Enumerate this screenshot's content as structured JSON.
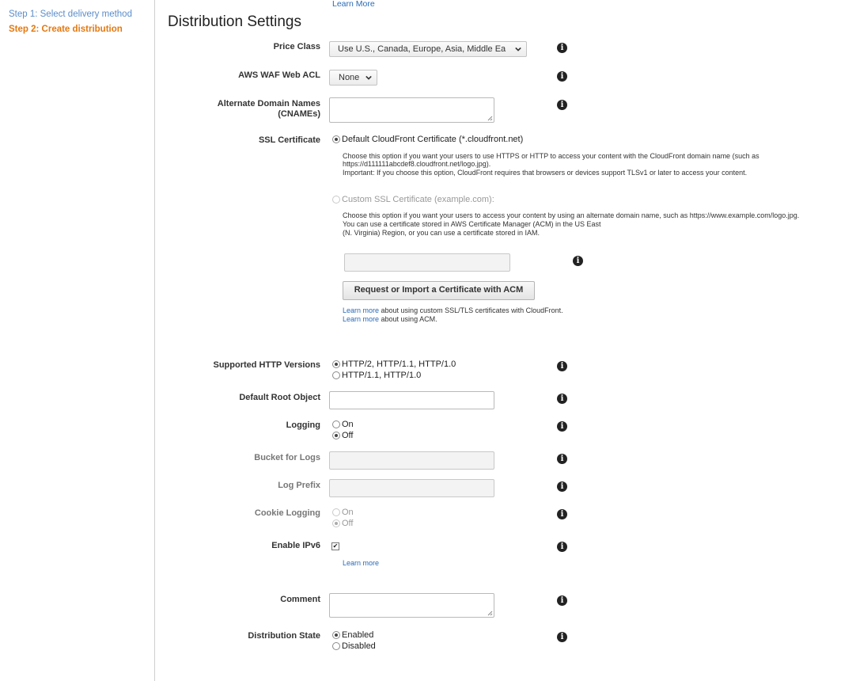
{
  "sidebar": {
    "step1": "Step 1: Select delivery method",
    "step2": "Step 2: Create distribution"
  },
  "top_link": "Learn More",
  "heading": "Distribution Settings",
  "price_class": {
    "label": "Price Class",
    "value": "Use U.S., Canada, Europe, Asia, Middle Ea"
  },
  "waf": {
    "label": "AWS WAF Web ACL",
    "value": "None"
  },
  "cnames": {
    "label_line1": "Alternate Domain Names",
    "label_line2": "(CNAMEs)"
  },
  "ssl": {
    "label": "SSL Certificate",
    "default_option": "Default CloudFront Certificate (*.cloudfront.net)",
    "default_desc_1": "Choose this option if you want your users to use HTTPS or HTTP to access your content with the CloudFront domain name (such as",
    "default_desc_2": "https://d111111abcdef8.cloudfront.net/logo.jpg).",
    "default_desc_3": "Important: If you choose this option, CloudFront requires that browsers or devices support TLSv1 or later to access your content.",
    "custom_option": "Custom SSL Certificate (example.com):",
    "custom_desc_1": "Choose this option if you want your users to access your content by using an alternate domain name, such as https://www.example.com/logo.jpg.",
    "custom_desc_2": "You can use a certificate stored in AWS Certificate Manager (ACM) in the US East",
    "custom_desc_3": "(N. Virginia) Region, or you can use a certificate stored in IAM.",
    "acm_button": "Request or Import a Certificate with ACM",
    "learn_more_1_link": "Learn more",
    "learn_more_1_text": " about using custom SSL/TLS certificates with CloudFront.",
    "learn_more_2_link": "Learn more",
    "learn_more_2_text": " about using ACM."
  },
  "http_versions": {
    "label": "Supported HTTP Versions",
    "option1": "HTTP/2, HTTP/1.1, HTTP/1.0",
    "option2": "HTTP/1.1, HTTP/1.0"
  },
  "root_object": {
    "label": "Default Root Object"
  },
  "logging": {
    "label": "Logging",
    "on": "On",
    "off": "Off"
  },
  "bucket": {
    "label": "Bucket for Logs"
  },
  "log_prefix": {
    "label": "Log Prefix"
  },
  "cookie_logging": {
    "label": "Cookie Logging",
    "on": "On",
    "off": "Off"
  },
  "ipv6": {
    "label": "Enable IPv6",
    "learn_more": "Learn more",
    "checked": true
  },
  "comment": {
    "label": "Comment"
  },
  "dist_state": {
    "label": "Distribution State",
    "enabled": "Enabled",
    "disabled": "Disabled"
  },
  "icons": {
    "info": "info-icon",
    "dropdown": "chevron-down-icon"
  },
  "colors": {
    "step_active": "#e47911",
    "step_link": "#5b8dc9",
    "link": "#2a6ab6"
  }
}
